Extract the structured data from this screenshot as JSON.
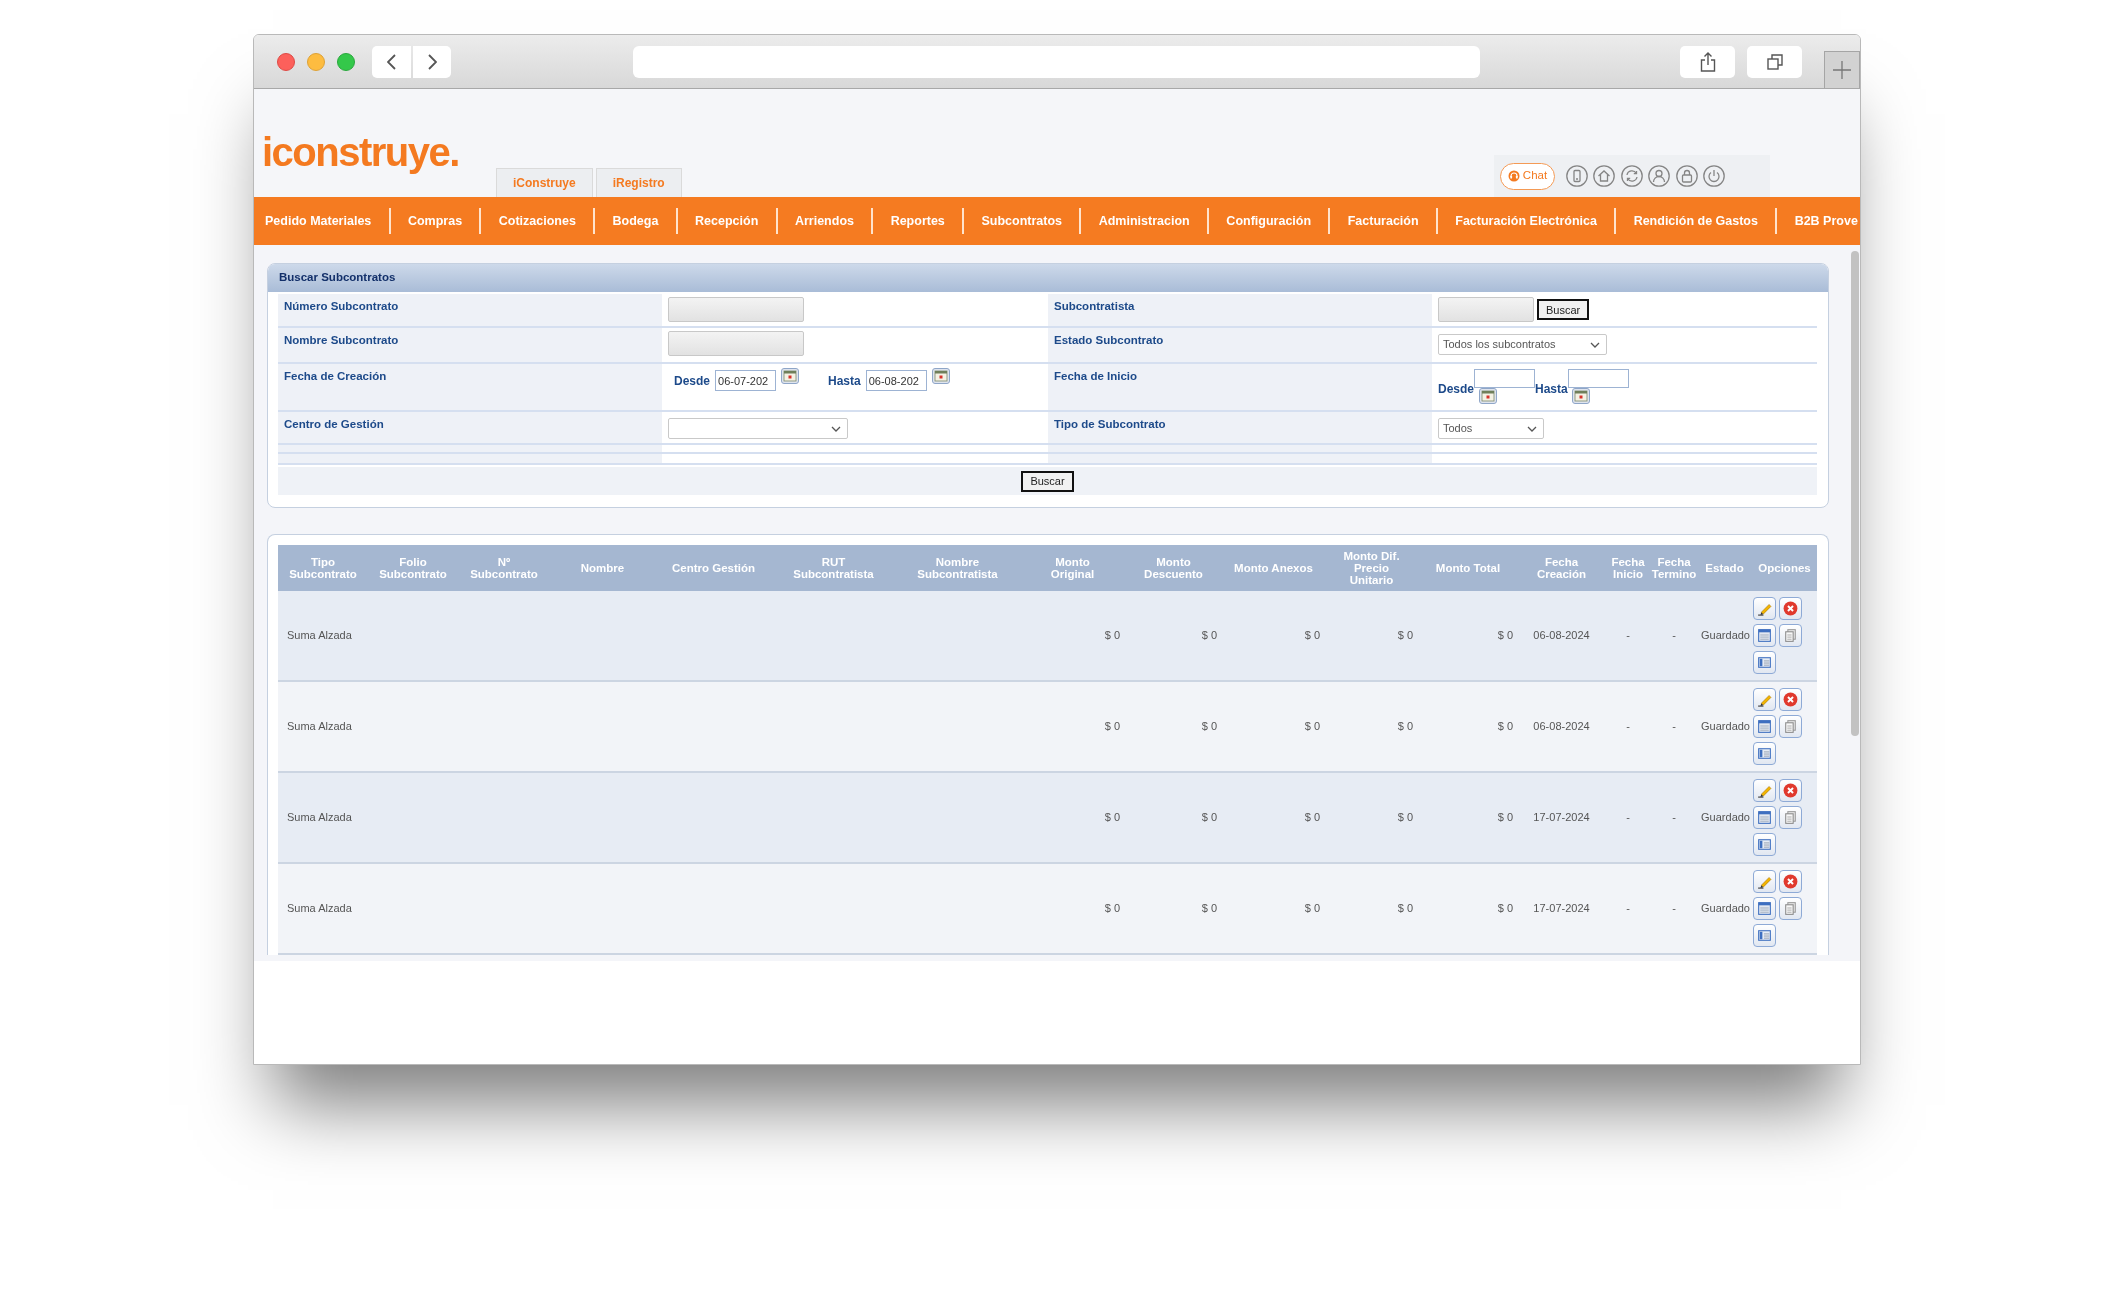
{
  "header": {
    "logo": "iconstruye.",
    "tabs": [
      {
        "label": "iConstruye",
        "selected": false
      },
      {
        "label": "iRegistro",
        "selected": false
      }
    ],
    "chat": "Chat"
  },
  "nav": [
    "Pedido Materiales",
    "Compras",
    "Cotizaciones",
    "Bodega",
    "Recepción",
    "Arriendos",
    "Reportes",
    "Subcontratos",
    "Administracion",
    "Configuración",
    "Facturación",
    "Facturación Electrónica",
    "Rendición de Gastos",
    "B2B Prove"
  ],
  "search_panel": {
    "title": "Buscar Subcontratos",
    "fields": [
      {
        "label": "Número Subcontrato",
        "kind": "text"
      },
      {
        "label": "Subcontratista",
        "kind": "text_search",
        "button": "Buscar"
      },
      {
        "label": "Nombre Subcontrato",
        "kind": "text"
      },
      {
        "label": "Estado Subcontrato",
        "kind": "select",
        "value": "Todos los subcontratos"
      },
      {
        "label": "Fecha de Creación",
        "kind": "date_range",
        "from_label": "Desde",
        "from_value": "06-07-202",
        "to_label": "Hasta",
        "to_value": "06-08-202"
      },
      {
        "label": "Fecha de Inicio",
        "kind": "date_range_wrapped",
        "from_label": "Desde",
        "to_label": "Hasta"
      },
      {
        "label": "Centro de Gestión",
        "kind": "select"
      },
      {
        "label": "Tipo de Subcontrato",
        "kind": "select",
        "value": "Todos"
      }
    ],
    "submit": "Buscar"
  },
  "results": {
    "columns": [
      "Tipo Subcontrato",
      "Folio Subcontrato",
      "Nº Subcontrato",
      "Nombre",
      "Centro Gestión",
      "RUT Subcontratista",
      "Nombre Subcontratista",
      "Monto Original",
      "Monto Descuento",
      "Monto Anexos",
      "Monto Dif. Precio Unitario",
      "Monto Total",
      "Fecha Creación",
      "Fecha Inicio",
      "Fecha Termino",
      "Estado",
      "Opciones"
    ],
    "rows": [
      {
        "tipo_subcontrato": "Suma Alzada",
        "monto_original": "$ 0",
        "monto_descuento": "$ 0",
        "monto_anexos": "$ 0",
        "monto_dif_precio_unitario": "$ 0",
        "monto_total": "$ 0",
        "fecha_creacion": "06-08-2024",
        "fecha_inicio": "-",
        "fecha_termino": "-",
        "estado": "Guardado"
      },
      {
        "tipo_subcontrato": "Suma Alzada",
        "monto_original": "$ 0",
        "monto_descuento": "$ 0",
        "monto_anexos": "$ 0",
        "monto_dif_precio_unitario": "$ 0",
        "monto_total": "$ 0",
        "fecha_creacion": "06-08-2024",
        "fecha_inicio": "-",
        "fecha_termino": "-",
        "estado": "Guardado"
      },
      {
        "tipo_subcontrato": "Suma Alzada",
        "monto_original": "$ 0",
        "monto_descuento": "$ 0",
        "monto_anexos": "$ 0",
        "monto_dif_precio_unitario": "$ 0",
        "monto_total": "$ 0",
        "fecha_creacion": "17-07-2024",
        "fecha_inicio": "-",
        "fecha_termino": "-",
        "estado": "Guardado"
      },
      {
        "tipo_subcontrato": "Suma Alzada",
        "monto_original": "$ 0",
        "monto_descuento": "$ 0",
        "monto_anexos": "$ 0",
        "monto_dif_precio_unitario": "$ 0",
        "monto_total": "$ 0",
        "fecha_creacion": "17-07-2024",
        "fecha_inicio": "-",
        "fecha_termino": "-",
        "estado": "Guardado"
      }
    ]
  }
}
